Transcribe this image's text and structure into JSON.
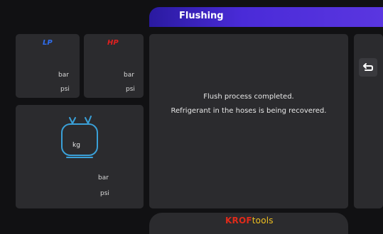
{
  "header": {
    "title": "Flushing"
  },
  "lp_gauge": {
    "label": "LP",
    "unit_bar": "bar",
    "unit_psi": "psi"
  },
  "hp_gauge": {
    "label": "HP",
    "unit_bar": "bar",
    "unit_psi": "psi"
  },
  "tank": {
    "unit_kg": "kg",
    "unit_bar": "bar",
    "unit_psi": "psi"
  },
  "message": {
    "line1": "Flush process completed.",
    "line2": "Refrigerant in the hoses is being recovered."
  },
  "side": {
    "back_icon": "return-icon"
  },
  "footer": {
    "logo_part1": "KROF",
    "logo_part2": "tools"
  },
  "colors": {
    "accent": "#4a2bd8",
    "lp": "#2f6ef0",
    "hp": "#e02020",
    "tank_outline": "#3aa0d8",
    "logo_red": "#e02a1a",
    "logo_yellow": "#f0c020"
  }
}
